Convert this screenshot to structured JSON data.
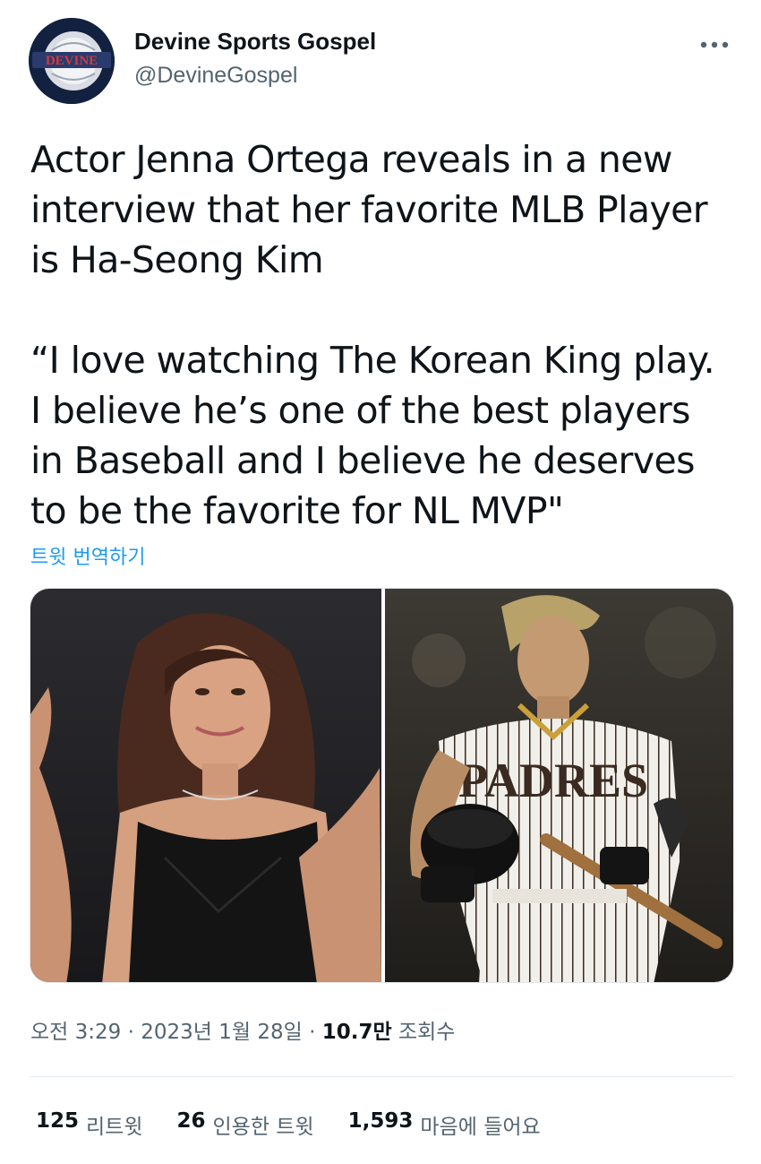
{
  "account": {
    "display_name": "Devine Sports Gospel",
    "handle": "@DevineGospel",
    "avatar_text": "DEVINE"
  },
  "tweet": {
    "text": "Actor Jenna Ortega reveals in a new\ninterview that her favorite MLB Player\nis Ha-Seong Kim\n\n“I love watching The Korean King play.\nI believe he’s one of the best players\nin Baseball and I believe he deserves\nto be the favorite for NL MVP\"",
    "translate_label": "트윗 번역하기"
  },
  "media": {
    "left_jersey_text": "",
    "right_jersey_text": "PADRES"
  },
  "meta": {
    "time": "오전 3:29",
    "date": "2023년 1월 28일",
    "views_count": "10.7만",
    "views_label": "조회수",
    "separator": "·"
  },
  "stats": {
    "retweets_count": "125",
    "retweets_label": "리트윗",
    "quotes_count": "26",
    "quotes_label": "인용한 트윗",
    "likes_count": "1,593",
    "likes_label": "마음에 들어요"
  },
  "colors": {
    "link": "#1d9bf0",
    "secondary_text": "#536471",
    "primary_text": "#0f1419",
    "avatar_bg": "#12213f"
  }
}
